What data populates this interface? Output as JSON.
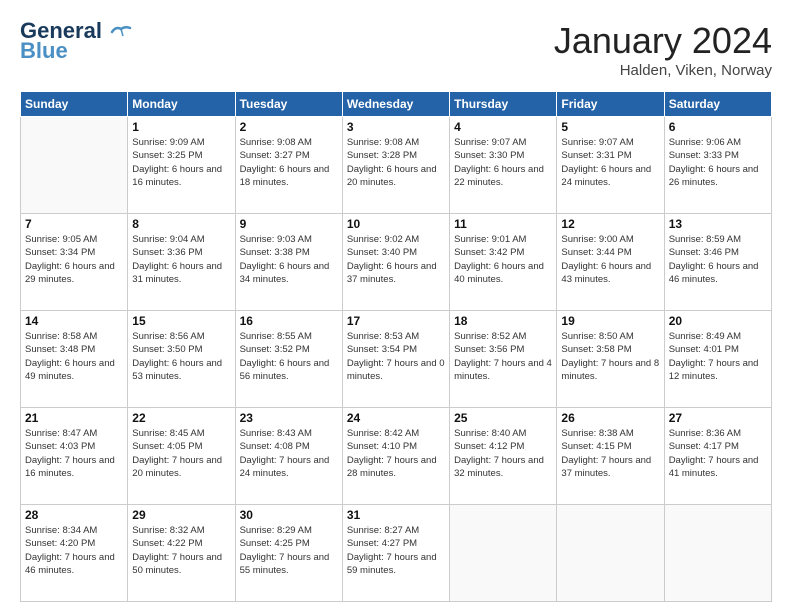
{
  "header": {
    "logo_line1": "General",
    "logo_line2": "Blue",
    "month": "January 2024",
    "location": "Halden, Viken, Norway"
  },
  "weekdays": [
    "Sunday",
    "Monday",
    "Tuesday",
    "Wednesday",
    "Thursday",
    "Friday",
    "Saturday"
  ],
  "weeks": [
    [
      {
        "day": "",
        "sunrise": "",
        "sunset": "",
        "daylight": ""
      },
      {
        "day": "1",
        "sunrise": "Sunrise: 9:09 AM",
        "sunset": "Sunset: 3:25 PM",
        "daylight": "Daylight: 6 hours and 16 minutes."
      },
      {
        "day": "2",
        "sunrise": "Sunrise: 9:08 AM",
        "sunset": "Sunset: 3:27 PM",
        "daylight": "Daylight: 6 hours and 18 minutes."
      },
      {
        "day": "3",
        "sunrise": "Sunrise: 9:08 AM",
        "sunset": "Sunset: 3:28 PM",
        "daylight": "Daylight: 6 hours and 20 minutes."
      },
      {
        "day": "4",
        "sunrise": "Sunrise: 9:07 AM",
        "sunset": "Sunset: 3:30 PM",
        "daylight": "Daylight: 6 hours and 22 minutes."
      },
      {
        "day": "5",
        "sunrise": "Sunrise: 9:07 AM",
        "sunset": "Sunset: 3:31 PM",
        "daylight": "Daylight: 6 hours and 24 minutes."
      },
      {
        "day": "6",
        "sunrise": "Sunrise: 9:06 AM",
        "sunset": "Sunset: 3:33 PM",
        "daylight": "Daylight: 6 hours and 26 minutes."
      }
    ],
    [
      {
        "day": "7",
        "sunrise": "Sunrise: 9:05 AM",
        "sunset": "Sunset: 3:34 PM",
        "daylight": "Daylight: 6 hours and 29 minutes."
      },
      {
        "day": "8",
        "sunrise": "Sunrise: 9:04 AM",
        "sunset": "Sunset: 3:36 PM",
        "daylight": "Daylight: 6 hours and 31 minutes."
      },
      {
        "day": "9",
        "sunrise": "Sunrise: 9:03 AM",
        "sunset": "Sunset: 3:38 PM",
        "daylight": "Daylight: 6 hours and 34 minutes."
      },
      {
        "day": "10",
        "sunrise": "Sunrise: 9:02 AM",
        "sunset": "Sunset: 3:40 PM",
        "daylight": "Daylight: 6 hours and 37 minutes."
      },
      {
        "day": "11",
        "sunrise": "Sunrise: 9:01 AM",
        "sunset": "Sunset: 3:42 PM",
        "daylight": "Daylight: 6 hours and 40 minutes."
      },
      {
        "day": "12",
        "sunrise": "Sunrise: 9:00 AM",
        "sunset": "Sunset: 3:44 PM",
        "daylight": "Daylight: 6 hours and 43 minutes."
      },
      {
        "day": "13",
        "sunrise": "Sunrise: 8:59 AM",
        "sunset": "Sunset: 3:46 PM",
        "daylight": "Daylight: 6 hours and 46 minutes."
      }
    ],
    [
      {
        "day": "14",
        "sunrise": "Sunrise: 8:58 AM",
        "sunset": "Sunset: 3:48 PM",
        "daylight": "Daylight: 6 hours and 49 minutes."
      },
      {
        "day": "15",
        "sunrise": "Sunrise: 8:56 AM",
        "sunset": "Sunset: 3:50 PM",
        "daylight": "Daylight: 6 hours and 53 minutes."
      },
      {
        "day": "16",
        "sunrise": "Sunrise: 8:55 AM",
        "sunset": "Sunset: 3:52 PM",
        "daylight": "Daylight: 6 hours and 56 minutes."
      },
      {
        "day": "17",
        "sunrise": "Sunrise: 8:53 AM",
        "sunset": "Sunset: 3:54 PM",
        "daylight": "Daylight: 7 hours and 0 minutes."
      },
      {
        "day": "18",
        "sunrise": "Sunrise: 8:52 AM",
        "sunset": "Sunset: 3:56 PM",
        "daylight": "Daylight: 7 hours and 4 minutes."
      },
      {
        "day": "19",
        "sunrise": "Sunrise: 8:50 AM",
        "sunset": "Sunset: 3:58 PM",
        "daylight": "Daylight: 7 hours and 8 minutes."
      },
      {
        "day": "20",
        "sunrise": "Sunrise: 8:49 AM",
        "sunset": "Sunset: 4:01 PM",
        "daylight": "Daylight: 7 hours and 12 minutes."
      }
    ],
    [
      {
        "day": "21",
        "sunrise": "Sunrise: 8:47 AM",
        "sunset": "Sunset: 4:03 PM",
        "daylight": "Daylight: 7 hours and 16 minutes."
      },
      {
        "day": "22",
        "sunrise": "Sunrise: 8:45 AM",
        "sunset": "Sunset: 4:05 PM",
        "daylight": "Daylight: 7 hours and 20 minutes."
      },
      {
        "day": "23",
        "sunrise": "Sunrise: 8:43 AM",
        "sunset": "Sunset: 4:08 PM",
        "daylight": "Daylight: 7 hours and 24 minutes."
      },
      {
        "day": "24",
        "sunrise": "Sunrise: 8:42 AM",
        "sunset": "Sunset: 4:10 PM",
        "daylight": "Daylight: 7 hours and 28 minutes."
      },
      {
        "day": "25",
        "sunrise": "Sunrise: 8:40 AM",
        "sunset": "Sunset: 4:12 PM",
        "daylight": "Daylight: 7 hours and 32 minutes."
      },
      {
        "day": "26",
        "sunrise": "Sunrise: 8:38 AM",
        "sunset": "Sunset: 4:15 PM",
        "daylight": "Daylight: 7 hours and 37 minutes."
      },
      {
        "day": "27",
        "sunrise": "Sunrise: 8:36 AM",
        "sunset": "Sunset: 4:17 PM",
        "daylight": "Daylight: 7 hours and 41 minutes."
      }
    ],
    [
      {
        "day": "28",
        "sunrise": "Sunrise: 8:34 AM",
        "sunset": "Sunset: 4:20 PM",
        "daylight": "Daylight: 7 hours and 46 minutes."
      },
      {
        "day": "29",
        "sunrise": "Sunrise: 8:32 AM",
        "sunset": "Sunset: 4:22 PM",
        "daylight": "Daylight: 7 hours and 50 minutes."
      },
      {
        "day": "30",
        "sunrise": "Sunrise: 8:29 AM",
        "sunset": "Sunset: 4:25 PM",
        "daylight": "Daylight: 7 hours and 55 minutes."
      },
      {
        "day": "31",
        "sunrise": "Sunrise: 8:27 AM",
        "sunset": "Sunset: 4:27 PM",
        "daylight": "Daylight: 7 hours and 59 minutes."
      },
      {
        "day": "",
        "sunrise": "",
        "sunset": "",
        "daylight": ""
      },
      {
        "day": "",
        "sunrise": "",
        "sunset": "",
        "daylight": ""
      },
      {
        "day": "",
        "sunrise": "",
        "sunset": "",
        "daylight": ""
      }
    ]
  ]
}
